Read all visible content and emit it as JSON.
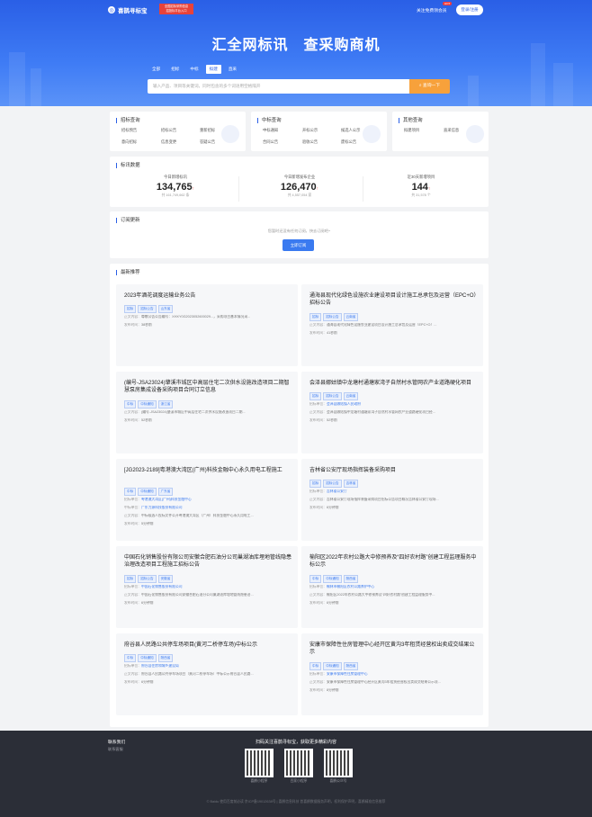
{
  "header": {
    "logo": "喜鹊寻标宝",
    "promo_line1": "全国招标采购信息",
    "promo_line2": "招投标平台入口",
    "vip": "关注免费领会员",
    "hot": "HOT",
    "login": "登录/注册"
  },
  "hero": {
    "slogan": "汇全网标讯　查采购商机",
    "tabs": [
      "全部",
      "招标",
      "中标",
      "拟建",
      "直采"
    ],
    "active_tab": "拟建",
    "placeholder": "输入产品、项目等关键词，同时包含的多个词语用空格隔开",
    "search_btn": "查询一下"
  },
  "query": {
    "bid": {
      "title": "招标查询",
      "links": [
        "招标预告",
        "招标公告",
        "重新招标",
        "意向招标",
        "信息变更",
        "答疑公告"
      ]
    },
    "win": {
      "title": "中标查询",
      "links": [
        "中标通知",
        "开标公示",
        "候选人公示",
        "合同公告",
        "验收公告",
        "废标公告"
      ]
    },
    "other": {
      "title": "其他查询",
      "links": [
        "拟建项目",
        "直采信息"
      ]
    }
  },
  "stats": {
    "title": "标讯数据",
    "items": [
      {
        "label": "今日新增标讯",
        "value": "134,765",
        "sub": "共 161,749,662 条"
      },
      {
        "label": "今日新增发布企业",
        "value": "126,470",
        "sub": "共 4,557,054 家"
      },
      {
        "label": "近30天新增项目",
        "value": "144",
        "sub": "共 31,578 个"
      }
    ]
  },
  "subscribe": {
    "title": "订阅更新",
    "hint": "您暂时还没有任何订阅，快去订阅吧~",
    "button": "立即订阅"
  },
  "recommend": {
    "title": "最新推荐",
    "items": [
      {
        "title": "2023年酒花调度运输业务公告",
        "tags": [
          "招标",
          "招标公告",
          "山东省"
        ],
        "rows": [
          [
            "正文内容：",
            "尊敬公告公告编号：XHXY0G2023052600029...，采购项目基本情况采..."
          ],
          [
            "发布时间：",
            "38秒前"
          ]
        ]
      },
      {
        "title": "通海县现代化绿色设施农业建设项目设计施工总承包及运营（EPC+O）招标公告",
        "tags": [
          "招标",
          "招标公告",
          "云南省"
        ],
        "rows": [
          [
            "正文内容：",
            "通海县现代化绿色设施农业建设项目设计施工总承包及运营（EPC+O）..."
          ],
          [
            "发布时间：",
            "41秒前"
          ]
        ]
      },
      {
        "title": "(编号-JSA23024)肇溪市城区中高层住宅二次供水设施改造项目二期智慧泵房集成设备采购项目合同订立信息",
        "tags": [
          "中标",
          "中标通知",
          "浙江省"
        ],
        "rows": [
          [
            "正文内容：",
            "(编号-JSA23024)肇溪市城区中高层住宅二次供水设施改造项目二期..."
          ],
          [
            "发布时间：",
            "52秒前"
          ]
        ]
      },
      {
        "title": "会泽县娜姑镇中龙塘村通塘家湾子自然村水管网农产业道路硬化项目",
        "tags": [
          "招标",
          "招标公告",
          "云南省"
        ],
        "rows": [
          [
            "招标单位：",
            "会泽县娜姑镇人民政府"
          ],
          [
            "正文内容：",
            "会泽县娜姑镇中龙塘村通塘家湾子自然村水管网农产业道路硬化项目经..."
          ],
          [
            "发布时间：",
            "52秒前"
          ]
        ]
      },
      {
        "title": "[JG2023-2189]粤港澳大湾区(广州)科技金融中心永久用电工程施工",
        "tags": [
          "中标",
          "中标通知",
          "广东省"
        ],
        "rows": [
          [
            "招标单位：",
            "粤港澳大湾区(广州)科技金融中心"
          ],
          [
            "中标单位：",
            "广东力源科技股份有限公司"
          ],
          [
            "正文内容：",
            "中标候选人投标文件公开粤港澳大湾区（广州）科技金融中心永久用电工..."
          ],
          [
            "发布时间：",
            "5分钟前"
          ]
        ]
      },
      {
        "title": "吉林省公安厅现场指挥装备采购项目",
        "tags": [
          "招标",
          "招标公告",
          "吉林省"
        ],
        "rows": [
          [
            "招标单位：",
            "吉林省公安厅"
          ],
          [
            "正文内容：",
            "吉林省公安厅现场指挥装备采购项目招标公告项目概况吉林省公安厅现场..."
          ],
          [
            "发布时间：",
            "6分钟前"
          ]
        ]
      },
      {
        "title": "中国石化销售股份有限公司安徽合肥石油分公司巢湖油库埋地管线隐患治理改造项目工程施工招标公告",
        "tags": [
          "招标",
          "招标公告",
          "安徽省"
        ],
        "rows": [
          [
            "招标单位：",
            "中国石化销售股份有限公司"
          ],
          [
            "正文内容：",
            "中国石化销售股份有限公司安徽合肥石油分公司巢湖油库埋地管线隐患治..."
          ],
          [
            "发布时间：",
            "6分钟前"
          ]
        ]
      },
      {
        "title": "榆阳区2022年农村公路大中修预养及“四好农村路”创建工程监理服务中标公示",
        "tags": [
          "中标",
          "中标通知",
          "陕西省"
        ],
        "rows": [
          [
            "招标单位：",
            "榆林市榆阳区农村公路养护中心"
          ],
          [
            "正文内容：",
            "榆阳区2022年农村公路大中修预养及“四好农村路”创建工程监理服务中..."
          ],
          [
            "发布时间：",
            "6分钟前"
          ]
        ]
      },
      {
        "title": "府谷县人民路公共停车场项目(黄河二桥停车场)中标公示",
        "tags": [
          "中标",
          "中标通知",
          "陕西省"
        ],
        "rows": [
          [
            "招标单位：",
            "府谷县住房和城乡建设局"
          ],
          [
            "正文内容：",
            "府谷县人民路公共停车场项目（黄河二桥停车场）中标公示府谷县人民路..."
          ],
          [
            "发布时间：",
            "6分钟前"
          ]
        ]
      },
      {
        "title": "安康市保障性住房管理中心经开区黄沟3年租赁经营权出卖成交结果公示",
        "tags": [
          "中标",
          "中标通知",
          "陕西省"
        ],
        "rows": [
          [
            "招标单位：",
            "安康市保障性住房管理中心"
          ],
          [
            "正文内容：",
            "安康市保障性住房管理中心经开区黄沟3年租赁经营权出卖成交结果公示项..."
          ],
          [
            "发布时间：",
            "8分钟前"
          ]
        ]
      }
    ]
  },
  "footer": {
    "contact_title": "联系我们",
    "contact_link": "联系客服",
    "follow": "扫码关注喜鹊寻标宝，获取更多精彩内容",
    "qrs": [
      "喜鹊小程序",
      "百家小程序",
      "喜鹊公众号"
    ],
    "copyright": "© Baidu 使用百度前必读 京ICP备19012638号 | 喜鹊信息科技 首喜鹊数据服务声明，权利保护声明，喜鹊精准信息推荐"
  },
  "colors": {
    "brand": "#2a5fe6",
    "accent": "#f7a13b",
    "hot": "#e8423a"
  }
}
